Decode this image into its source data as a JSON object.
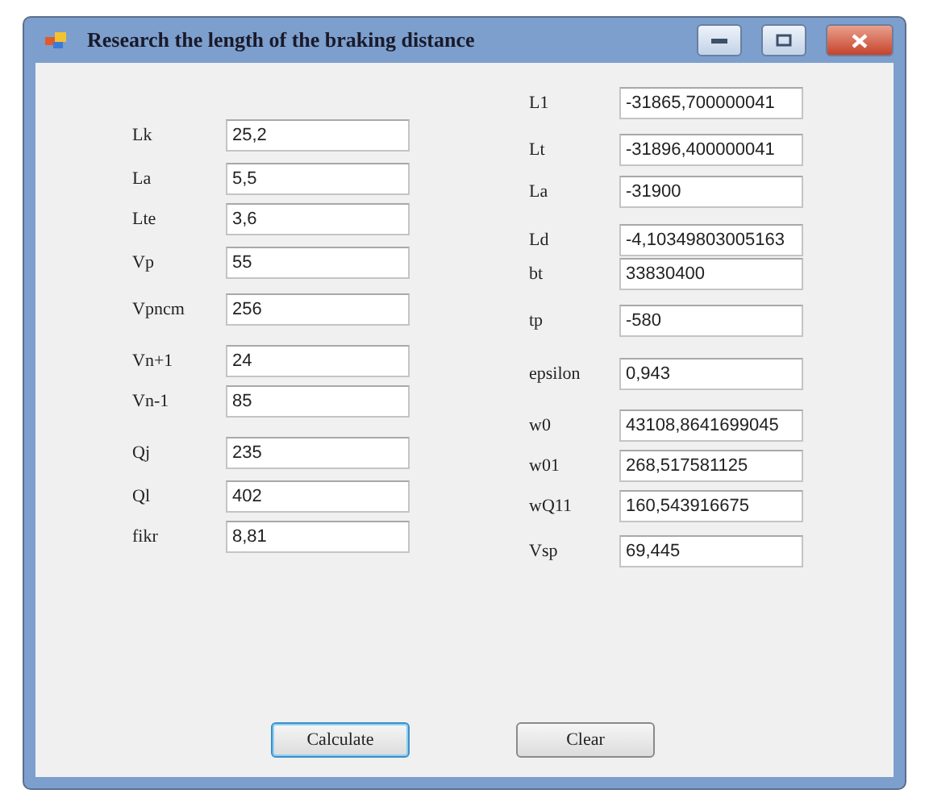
{
  "window": {
    "title": "Research the length of the braking distance"
  },
  "left_fields": [
    {
      "label": "Lk",
      "value": "25,2"
    },
    {
      "label": "La",
      "value": "5,5"
    },
    {
      "label": "Lte",
      "value": "3,6"
    },
    {
      "label": "Vp",
      "value": "55"
    },
    {
      "label": "Vpncm",
      "value": "256"
    },
    {
      "label": "Vn+1",
      "value": "24"
    },
    {
      "label": "Vn-1",
      "value": "85"
    },
    {
      "label": "Qj",
      "value": "235"
    },
    {
      "label": "Ql",
      "value": "402"
    },
    {
      "label": "fikr",
      "value": "8,81"
    }
  ],
  "right_fields": [
    {
      "label": "L1",
      "value": "-31865,700000041"
    },
    {
      "label": "Lt",
      "value": "-31896,400000041"
    },
    {
      "label": "La",
      "value": "-31900"
    },
    {
      "label": "Ld",
      "value": "-4,10349803005163"
    },
    {
      "label": "bt",
      "value": "33830400"
    },
    {
      "label": "tp",
      "value": "-580"
    },
    {
      "label": "epsilon",
      "value": "0,943"
    },
    {
      "label": "w0",
      "value": "43108,8641699045"
    },
    {
      "label": "w01",
      "value": "268,517581125"
    },
    {
      "label": "wQ11",
      "value": "160,543916675"
    },
    {
      "label": "Vsp",
      "value": "69,445"
    }
  ],
  "buttons": [
    {
      "label": "Calculate",
      "focused": true
    },
    {
      "label": "Clear",
      "focused": false
    }
  ]
}
